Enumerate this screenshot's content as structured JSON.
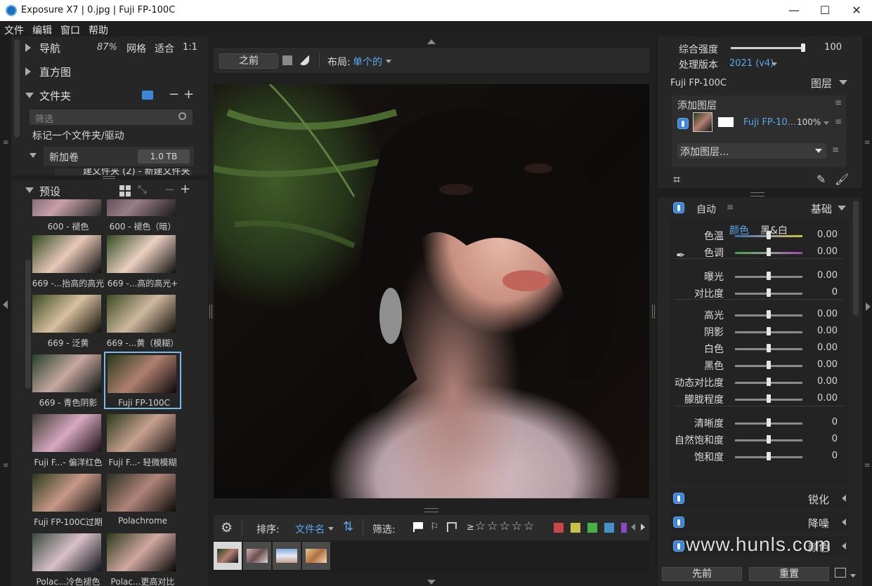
{
  "window": {
    "title": "Exposure X7 | 0.jpg | Fuji FP-100C",
    "minimize": "—",
    "maximize": "☐",
    "close": "✕"
  },
  "menu": [
    "文件",
    "编辑",
    "窗口",
    "帮助"
  ],
  "left": {
    "nav": {
      "label": "导航",
      "zoom": "87%",
      "grid": "网格",
      "fit": "适合",
      "one": "1:1"
    },
    "histogram": {
      "label": "直方图"
    },
    "folders": {
      "label": "文件夹",
      "filter_placeholder": "筛选",
      "mark": "标记一个文件夹/驱动",
      "volume": "新加卷",
      "size": "1.0 TB",
      "cut_item": "建文件夹 (2) - 新建文件夹"
    },
    "presets": {
      "label": "预设",
      "items": [
        {
          "name": "600 - 褪色"
        },
        {
          "name": "600 - 褪色（暗）"
        },
        {
          "name": "669 -...抬高的高光"
        },
        {
          "name": "669 -...高的高光+"
        },
        {
          "name": "669 - 泛黄"
        },
        {
          "name": "669 -...黄（模糊）"
        },
        {
          "name": "669 - 青色阴影"
        },
        {
          "name": "Fuji FP-100C"
        },
        {
          "name": "Fuji F...- 偏洋红色"
        },
        {
          "name": "Fuji F...- 轻微模糊"
        },
        {
          "name": "Fuji FP-100C过期"
        },
        {
          "name": "Polachrome"
        },
        {
          "name": "Polac...冷色褪色"
        },
        {
          "name": "Polac...更高对比"
        }
      ]
    }
  },
  "center": {
    "before": "之前",
    "layout_label": "布局:",
    "layout_value": "单个的",
    "sort_label": "排序:",
    "sort_value": "文件名",
    "filter_label": "筛选:",
    "ge": "≥",
    "stars": "☆☆☆☆☆",
    "colors": [
      "#c84848",
      "#c8c048",
      "#48b048",
      "#4890c8",
      "#8848c8"
    ]
  },
  "right": {
    "overall_label": "综合强度",
    "overall_value": "100",
    "overall_level": 1.0,
    "process_label": "处理版本",
    "process_value": "2021 (v4)",
    "preset_name": "Fuji FP-100C",
    "layers_label": "图层",
    "add_layer": "添加图层",
    "layer_name": "Fuji FP-10...",
    "layer_opacity": "100%",
    "add_layer_dropdown": "添加图层...",
    "auto": "自动",
    "basic": "基础",
    "color_tab": "颜色",
    "bw_tab": "黑&白",
    "sliders": [
      {
        "label": "色温",
        "value": "0.00"
      },
      {
        "label": "色调",
        "value": "0.00"
      },
      {
        "label": "曝光",
        "value": "0.00"
      },
      {
        "label": "对比度",
        "value": "0"
      },
      {
        "label": "高光",
        "value": "0.00"
      },
      {
        "label": "阴影",
        "value": "0.00"
      },
      {
        "label": "白色",
        "value": "0.00"
      },
      {
        "label": "黑色",
        "value": "0.00"
      },
      {
        "label": "动态对比度",
        "value": "0.00"
      },
      {
        "label": "朦胧程度",
        "value": "0.00"
      },
      {
        "label": "清晰度",
        "value": "0"
      },
      {
        "label": "自然饱和度",
        "value": "0"
      },
      {
        "label": "饱和度",
        "value": "0"
      }
    ],
    "sharpen": "锐化",
    "denoise": "降噪",
    "color_sec": "颜色",
    "prev_btn": "先前",
    "reset_btn": "重置"
  },
  "watermark": "www.hunls.com"
}
